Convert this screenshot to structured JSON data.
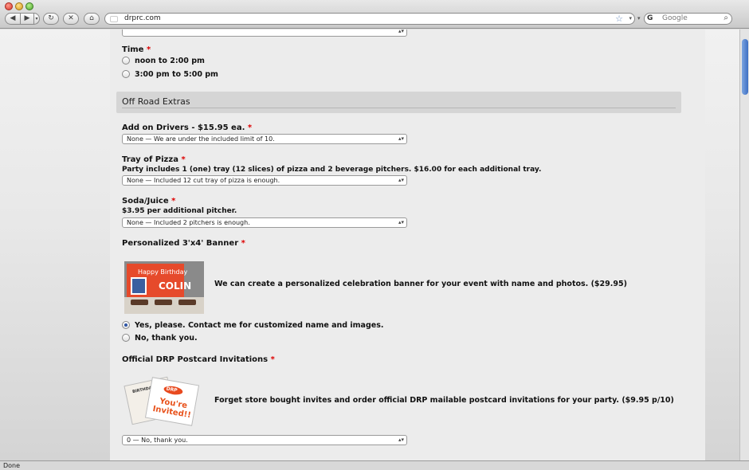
{
  "browser": {
    "url": "drprc.com",
    "search_placeholder": "Google",
    "status": "Done",
    "nav": {
      "back": "◀",
      "forward": "▶",
      "history": "▾",
      "reload": "↻",
      "stop": "✕",
      "home": "⌂",
      "star": "☆",
      "dropdown": "▾",
      "search": "⌕",
      "search_engine": "G"
    }
  },
  "form": {
    "time": {
      "label": "Time",
      "required": "*",
      "options": [
        "noon to 2:00 pm",
        "3:00 pm to 5:00 pm"
      ]
    },
    "section": {
      "title": "Off Road Extras"
    },
    "drivers": {
      "label": "Add on Drivers - $15.95 ea.",
      "required": "*",
      "selected": "None — We are under the included limit of 10."
    },
    "pizza": {
      "label": "Tray of Pizza",
      "required": "*",
      "note": "Party includes 1 (one) tray (12 slices) of pizza and 2 beverage pitchers. $16.00 for each additional tray.",
      "selected": "None — Included 12 cut tray of pizza is enough."
    },
    "soda": {
      "label": "Soda/Juice",
      "required": "*",
      "note": "$3.95 per additional pitcher.",
      "selected": "None — Included 2 pitchers is enough."
    },
    "banner": {
      "label": "Personalized 3'x4' Banner",
      "required": "*",
      "image_text_line1": "Happy Birthday",
      "image_text_line2": "COLIN",
      "description": "We can create a personalized celebration banner for your event with name and photos. ($29.95)",
      "options": [
        "Yes, please. Contact me for customized name and images.",
        "No, thank you."
      ],
      "selected_index": 0
    },
    "postcard": {
      "label": "Official DRP Postcard Invitations",
      "required": "*",
      "image_logo": "DRP",
      "image_text": "You're Invited!!",
      "image_back_text": "BIRTHDAY PARTY",
      "description": "Forget store bought invites and order official DRP mailable postcard invitations for your party. ($9.95 p/10)",
      "selected": "0 — No, thank you."
    }
  }
}
